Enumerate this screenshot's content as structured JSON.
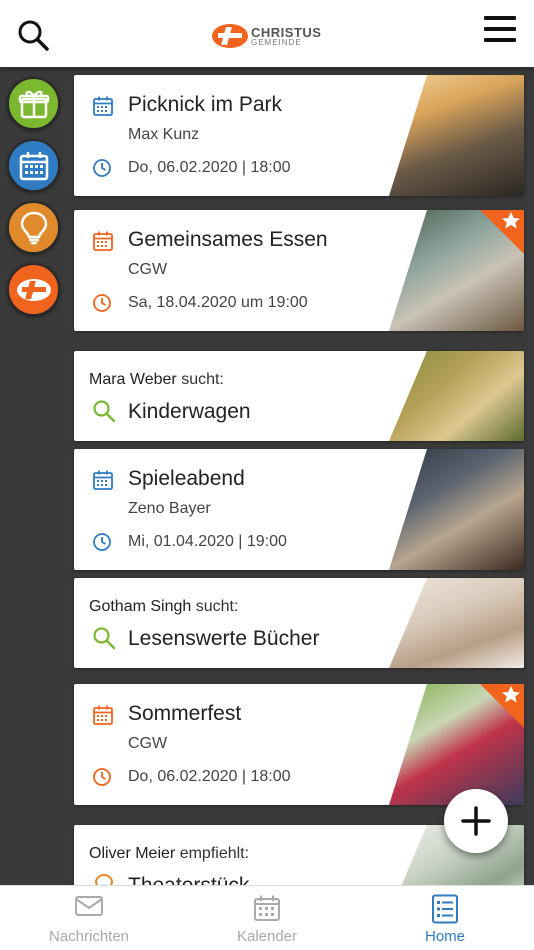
{
  "header": {
    "logo_main": "CHRISTUS",
    "logo_sub": "GEMEINDE",
    "search_icon": "search-icon",
    "menu_icon": "hamburger-icon"
  },
  "sidebar": {
    "items": [
      {
        "name": "gift",
        "color": "#7cb82f"
      },
      {
        "name": "calendar",
        "color": "#2f7cc2"
      },
      {
        "name": "idea",
        "color": "#e08a2c"
      },
      {
        "name": "christus",
        "color": "#f0641e"
      }
    ]
  },
  "cards": [
    {
      "type": "event",
      "title": "Picknick im Park",
      "sub": "Max Kunz",
      "meta": "Do, 06.02.2020 | 18:00",
      "accent": "#2f7cc2",
      "starred": false
    },
    {
      "type": "event",
      "title": "Gemeinsames Essen",
      "sub": "CGW",
      "meta": "Sa, 18.04.2020 um 19:00",
      "accent": "#f0641e",
      "starred": true
    },
    {
      "type": "request",
      "who": "Mara Weber",
      "verb": "sucht:",
      "title": "Kinderwagen",
      "accent": "#7cb82f"
    },
    {
      "type": "event",
      "title": "Spieleabend",
      "sub": "Zeno Bayer",
      "meta": "Mi, 01.04.2020 | 19:00",
      "accent": "#2f7cc2",
      "starred": false
    },
    {
      "type": "request",
      "who": "Gotham Singh",
      "verb": "sucht:",
      "title": "Lesenswerte Bücher",
      "accent": "#7cb82f"
    },
    {
      "type": "event",
      "title": "Sommerfest",
      "sub": "CGW",
      "meta": "Do, 06.02.2020 | 18:00",
      "accent": "#f0641e",
      "starred": true
    },
    {
      "type": "recommend",
      "who": "Oliver Meier",
      "verb": "empfiehlt:",
      "title": "Theaterstück",
      "accent": "#e08a2c"
    }
  ],
  "fab": {
    "label": "+"
  },
  "tabs": [
    {
      "label": "Nachrichten",
      "icon": "mail-icon",
      "active": false
    },
    {
      "label": "Kalender",
      "icon": "calendar-icon",
      "active": false
    },
    {
      "label": "Home",
      "icon": "list-icon",
      "active": true
    }
  ]
}
